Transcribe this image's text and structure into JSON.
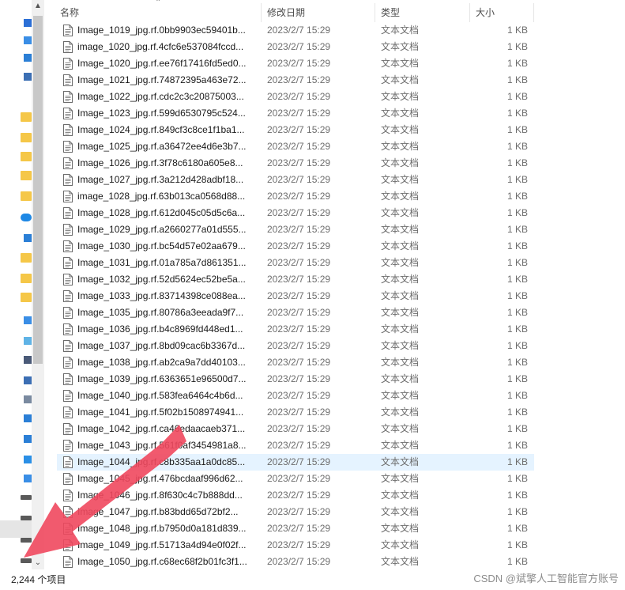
{
  "columns": {
    "name": "名称",
    "date": "修改日期",
    "type": "类型",
    "size": "大小"
  },
  "files": [
    {
      "name": "Image_1019_jpg.rf.0bb9903ec59401b...",
      "date": "2023/2/7 15:29",
      "type": "文本文档",
      "size": "1 KB"
    },
    {
      "name": "image_1020_jpg.rf.4cfc6e537084fccd...",
      "date": "2023/2/7 15:29",
      "type": "文本文档",
      "size": "1 KB"
    },
    {
      "name": "Image_1020_jpg.rf.ee76f17416fd5ed0...",
      "date": "2023/2/7 15:29",
      "type": "文本文档",
      "size": "1 KB"
    },
    {
      "name": "Image_1021_jpg.rf.74872395a463e72...",
      "date": "2023/2/7 15:29",
      "type": "文本文档",
      "size": "1 KB"
    },
    {
      "name": "Image_1022_jpg.rf.cdc2c3c20875003...",
      "date": "2023/2/7 15:29",
      "type": "文本文档",
      "size": "1 KB"
    },
    {
      "name": "Image_1023_jpg.rf.599d6530795c524...",
      "date": "2023/2/7 15:29",
      "type": "文本文档",
      "size": "1 KB"
    },
    {
      "name": "Image_1024_jpg.rf.849cf3c8ce1f1ba1...",
      "date": "2023/2/7 15:29",
      "type": "文本文档",
      "size": "1 KB"
    },
    {
      "name": "Image_1025_jpg.rf.a36472ee4d6e3b7...",
      "date": "2023/2/7 15:29",
      "type": "文本文档",
      "size": "1 KB"
    },
    {
      "name": "Image_1026_jpg.rf.3f78c6180a605e8...",
      "date": "2023/2/7 15:29",
      "type": "文本文档",
      "size": "1 KB"
    },
    {
      "name": "Image_1027_jpg.rf.3a212d428adbf18...",
      "date": "2023/2/7 15:29",
      "type": "文本文档",
      "size": "1 KB"
    },
    {
      "name": "image_1028_jpg.rf.63b013ca0568d88...",
      "date": "2023/2/7 15:29",
      "type": "文本文档",
      "size": "1 KB"
    },
    {
      "name": "Image_1028_jpg.rf.612d045c05d5c6a...",
      "date": "2023/2/7 15:29",
      "type": "文本文档",
      "size": "1 KB"
    },
    {
      "name": "Image_1029_jpg.rf.a2660277a01d555...",
      "date": "2023/2/7 15:29",
      "type": "文本文档",
      "size": "1 KB"
    },
    {
      "name": "Image_1030_jpg.rf.bc54d57e02aa679...",
      "date": "2023/2/7 15:29",
      "type": "文本文档",
      "size": "1 KB"
    },
    {
      "name": "Image_1031_jpg.rf.01a785a7d861351...",
      "date": "2023/2/7 15:29",
      "type": "文本文档",
      "size": "1 KB"
    },
    {
      "name": "Image_1032_jpg.rf.52d5624ec52be5a...",
      "date": "2023/2/7 15:29",
      "type": "文本文档",
      "size": "1 KB"
    },
    {
      "name": "Image_1033_jpg.rf.83714398ce088ea...",
      "date": "2023/2/7 15:29",
      "type": "文本文档",
      "size": "1 KB"
    },
    {
      "name": "Image_1035_jpg.rf.80786a3eeada9f7...",
      "date": "2023/2/7 15:29",
      "type": "文本文档",
      "size": "1 KB"
    },
    {
      "name": "Image_1036_jpg.rf.b4c8969fd448ed1...",
      "date": "2023/2/7 15:29",
      "type": "文本文档",
      "size": "1 KB"
    },
    {
      "name": "Image_1037_jpg.rf.8bd09cac6b3367d...",
      "date": "2023/2/7 15:29",
      "type": "文本文档",
      "size": "1 KB"
    },
    {
      "name": "Image_1038_jpg.rf.ab2ca9a7dd40103...",
      "date": "2023/2/7 15:29",
      "type": "文本文档",
      "size": "1 KB"
    },
    {
      "name": "Image_1039_jpg.rf.6363651e96500d7...",
      "date": "2023/2/7 15:29",
      "type": "文本文档",
      "size": "1 KB"
    },
    {
      "name": "Image_1040_jpg.rf.583fea6464c4b6d...",
      "date": "2023/2/7 15:29",
      "type": "文本文档",
      "size": "1 KB"
    },
    {
      "name": "Image_1041_jpg.rf.5f02b1508974941...",
      "date": "2023/2/7 15:29",
      "type": "文本文档",
      "size": "1 KB"
    },
    {
      "name": "Image_1042_jpg.rf.ca46edaacaeb371...",
      "date": "2023/2/7 15:29",
      "type": "文本文档",
      "size": "1 KB"
    },
    {
      "name": "Image_1043_jpg.rf.561f0af3454981a8...",
      "date": "2023/2/7 15:29",
      "type": "文本文档",
      "size": "1 KB"
    },
    {
      "name": "Image_1044_jpg.rf.c8b335aa1a0dc85...",
      "date": "2023/2/7 15:29",
      "type": "文本文档",
      "size": "1 KB",
      "selected": true
    },
    {
      "name": "Image_1045_jpg.rf.476bcdaaf996d62...",
      "date": "2023/2/7 15:29",
      "type": "文本文档",
      "size": "1 KB"
    },
    {
      "name": "Image_1046_jpg.rf.8f630c4c7b888dd...",
      "date": "2023/2/7 15:29",
      "type": "文本文档",
      "size": "1 KB"
    },
    {
      "name": "Image_1047_jpg.rf.b83bdd65d72bf2...",
      "date": "2023/2/7 15:29",
      "type": "文本文档",
      "size": "1 KB"
    },
    {
      "name": "Image_1048_jpg.rf.b7950d0a181d839...",
      "date": "2023/2/7 15:29",
      "type": "文本文档",
      "size": "1 KB"
    },
    {
      "name": "Image_1049_jpg.rf.51713a4d94e0f02f...",
      "date": "2023/2/7 15:29",
      "type": "文本文档",
      "size": "1 KB"
    },
    {
      "name": "Image_1050_jpg.rf.c68ec68f2b01fc3f1...",
      "date": "2023/2/7 15:29",
      "type": "文本文档",
      "size": "1 KB"
    }
  ],
  "status": {
    "item_count": "2,244 个项目"
  },
  "watermark": "CSDN @斌擎人工智能官方账号",
  "colors": {
    "selected_row": "#e5f3ff",
    "arrow": "#f0485e",
    "accent": "#0a64c8"
  },
  "nav_icons": [
    "pin-icon",
    "folder-blue-icon",
    "download-icon",
    "picture-icon",
    "folder-icon",
    "folder-icon",
    "folder-icon",
    "folder-icon",
    "folder-icon",
    "onedrive-cloud-icon",
    "person-icon",
    "folder-icon",
    "folder-icon",
    "folder-icon",
    "this-pc-icon",
    "3d-objects-icon",
    "video-icon",
    "picture-icon",
    "document-icon",
    "download-icon",
    "music-icon",
    "desktop-icon",
    "windows-drive-icon",
    "drive-icon",
    "drive-icon",
    "drive-icon",
    "drive-icon"
  ]
}
